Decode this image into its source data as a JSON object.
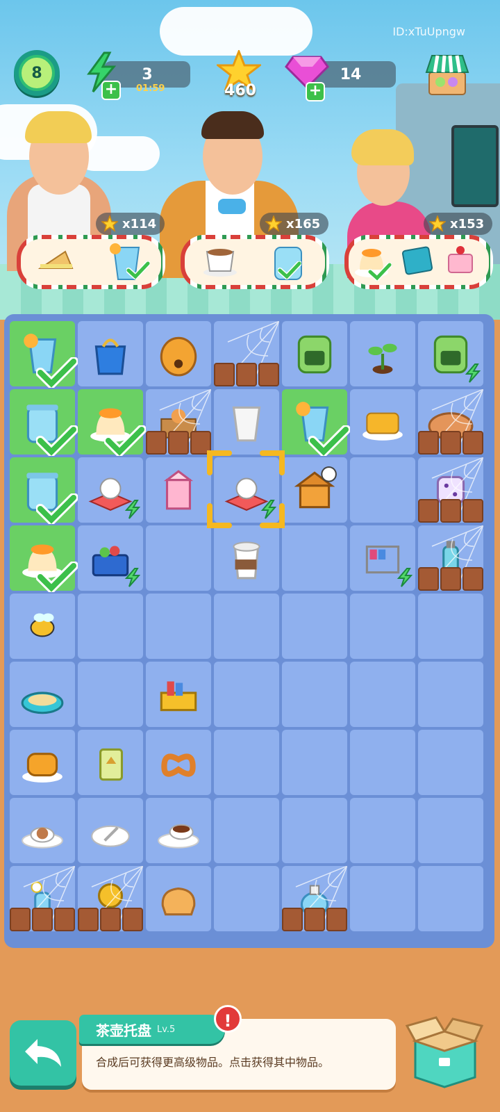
{
  "account": {
    "id_text": "ID:xTuUpngw"
  },
  "hud": {
    "level": "8",
    "energy": {
      "value": "3",
      "timer": "01:59",
      "plus": "+"
    },
    "stars": {
      "value": "460"
    },
    "gems": {
      "value": "14",
      "plus": "+"
    },
    "shop_icon": "shop-icon"
  },
  "customers": [
    {
      "name": "customer-left",
      "reward": "x114",
      "orders": [
        "sandwich",
        "blue-lemonade-done"
      ]
    },
    {
      "name": "customer-center",
      "reward": "x165",
      "orders": [
        "latte-cup",
        "blue-lemonade-jar-done"
      ]
    },
    {
      "name": "customer-right",
      "reward": "x153",
      "orders": [
        "orange-pudding-done",
        "blue-book",
        "strawberry-cake"
      ]
    }
  ],
  "board": {
    "rows": 9,
    "cols": 7,
    "cells": [
      [
        "blue-lemonade-done",
        "blue-shopping-bag",
        "beehive",
        "cat-in-web",
        "green-oven",
        "sprout",
        "green-oven-sparkle"
      ],
      [
        "blue-lemonade-jar-done",
        "orange-pudding-done",
        "cat-box-web",
        "paper-cup",
        "blue-lemonade-done",
        "honey-toast",
        "pie-web"
      ],
      [
        "blue-lemonade-jar-done",
        "teapot-tray",
        "milk-carton",
        "teapot-tray-selected",
        "honey-hut-timer",
        "empty",
        "dice-web"
      ],
      [
        "orange-pudding-done",
        "picnic-basket",
        "empty",
        "coffee-cup",
        "empty",
        "book-cart",
        "water-bottle-web"
      ],
      [
        "bee",
        "empty",
        "empty",
        "empty",
        "empty",
        "empty",
        "empty"
      ],
      [
        "sandbox",
        "empty",
        "book-box",
        "empty",
        "empty",
        "empty",
        "empty"
      ],
      [
        "honey-cake",
        "green-milk-box",
        "pretzel",
        "empty",
        "empty",
        "empty",
        "empty"
      ],
      [
        "cinnamon-tea",
        "plate-spoon",
        "tea-cup",
        "empty",
        "empty",
        "empty",
        "empty"
      ],
      [
        "flower-vase-web",
        "honey-flower-web",
        "bread-slice",
        "empty",
        "perfume-web",
        "empty",
        "empty"
      ]
    ]
  },
  "info_panel": {
    "title": "茶壶托盘",
    "level": "Lv.5",
    "description": "合成后可获得更高级物品。点击获得其中物品。",
    "alert": "!"
  },
  "colors": {
    "board_bg": "#6b8fd6",
    "cell_bg": "#8fb0ee",
    "done_bg": "#6ad064",
    "accent_teal": "#33c3a5",
    "selector_gold": "#f5b820"
  }
}
